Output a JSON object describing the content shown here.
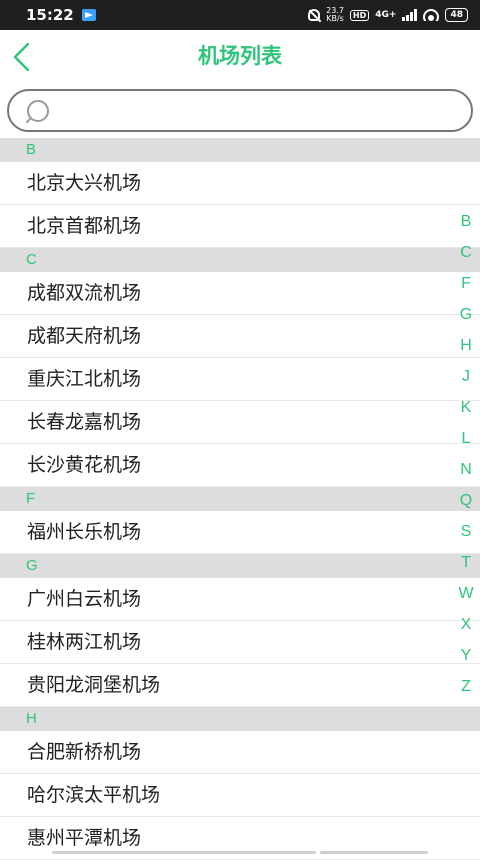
{
  "status_bar": {
    "time": "15:22",
    "speed_value": "23.7",
    "speed_unit": "KB/s",
    "hd_label": "HD",
    "network_label": "4G+",
    "battery_level": "48"
  },
  "nav": {
    "title": "机场列表"
  },
  "search": {
    "value": "",
    "placeholder": ""
  },
  "sections": [
    {
      "letter": "B",
      "items": [
        "北京大兴机场",
        "北京首都机场"
      ]
    },
    {
      "letter": "C",
      "items": [
        "成都双流机场",
        "成都天府机场",
        "重庆江北机场",
        "长春龙嘉机场",
        "长沙黄花机场"
      ]
    },
    {
      "letter": "F",
      "items": [
        "福州长乐机场"
      ]
    },
    {
      "letter": "G",
      "items": [
        "广州白云机场",
        "桂林两江机场",
        "贵阳龙洞堡机场"
      ]
    },
    {
      "letter": "H",
      "items": [
        "合肥新桥机场",
        "哈尔滨太平机场",
        "惠州平潭机场"
      ]
    }
  ],
  "index_letters": [
    "B",
    "C",
    "F",
    "G",
    "H",
    "J",
    "K",
    "L",
    "N",
    "Q",
    "S",
    "T",
    "W",
    "X",
    "Y",
    "Z"
  ],
  "colors": {
    "accent": "#2ec47a",
    "section_bg": "#dddddd",
    "status_bar_bg": "#1f1f1f"
  }
}
